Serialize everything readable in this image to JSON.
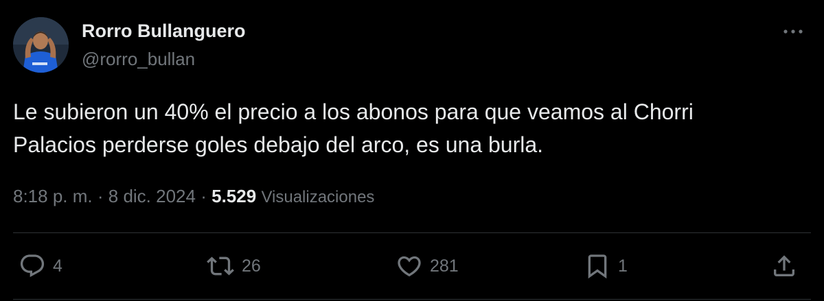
{
  "author": {
    "name": "Rorro Bullanguero",
    "handle": "@rorro_bullan"
  },
  "tweet": {
    "text": "Le subieron un 40% el precio a los abonos para que veamos al Chorri\nPalacios perderse goles debajo del arco, es una burla.",
    "time": "8:18 p. m.",
    "separator": "·",
    "date": "8 dic. 2024",
    "views_count": "5.529",
    "views_label": "Visualizaciones"
  },
  "actions": {
    "replies": "4",
    "retweets": "26",
    "likes": "281",
    "bookmarks": "1"
  },
  "icons": {
    "more": "more-horizontal-icon",
    "reply": "reply-icon",
    "retweet": "retweet-icon",
    "like": "heart-icon",
    "bookmark": "bookmark-icon",
    "share": "share-icon"
  },
  "colors": {
    "background": "#000000",
    "primary_text": "#e7e9ea",
    "secondary_text": "#71767b",
    "divider": "#2f3336"
  }
}
